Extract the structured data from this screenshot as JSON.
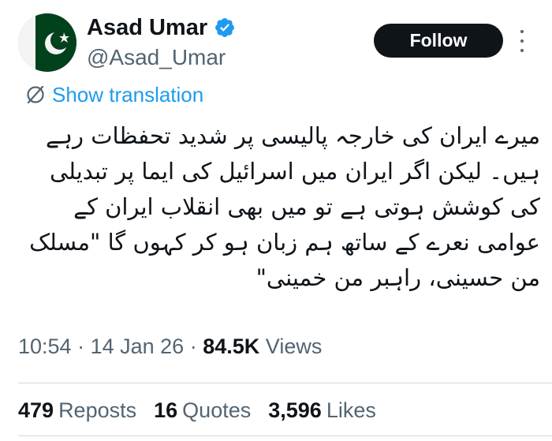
{
  "colors": {
    "accent": "#1d9bf0",
    "text": "#0f1419",
    "muted": "#536471",
    "flag_green": "#01411c"
  },
  "author": {
    "name": "Asad Umar",
    "handle": "@Asad_Umar",
    "avatar_icon": "pakistan-flag-icon",
    "verified_icon": "verified-badge-icon"
  },
  "actions": {
    "follow_label": "Follow",
    "more_icon": "more-options-icon"
  },
  "translation": {
    "label": "Show translation",
    "icon": "translate-icon"
  },
  "tweet": {
    "lines": [
      "میرے ایران کی خارجہ پالیسی پر شدید تحفظات رہے",
      "ہیں۔ لیکن اگر ایران میں اسرائیل کی ایما پر تبدیلی",
      "کی کوشش ہوتی ہے تو میں بھی انقلاب ایران کے",
      "عوامی نعرے کے ساتھ ہم زبان ہو کر کہوں گا \"مسلک",
      "من حسینی، راہبر من خمینی\""
    ]
  },
  "meta": {
    "time": "10:54",
    "date": "14 Jan 26",
    "views_count": "84.5K",
    "views_label": "Views"
  },
  "stats": {
    "reposts_count": "479",
    "reposts_label": "Reposts",
    "quotes_count": "16",
    "quotes_label": "Quotes",
    "likes_count": "3,596",
    "likes_label": "Likes"
  }
}
